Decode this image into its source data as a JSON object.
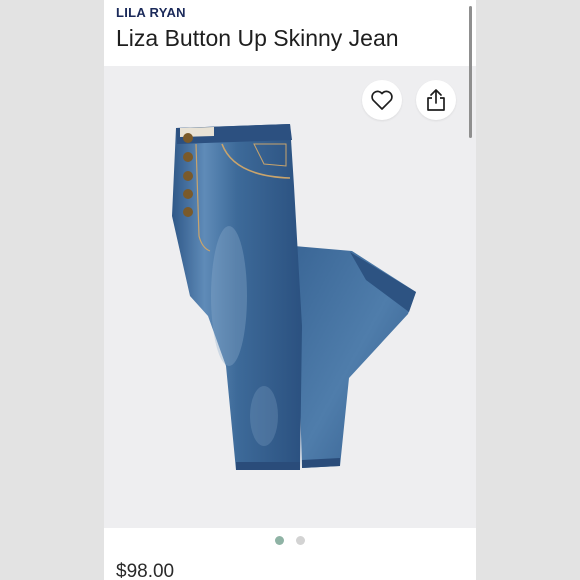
{
  "product": {
    "brand": "LILA RYAN",
    "title": "Liza Button Up Skinny Jean",
    "price": "$98.00"
  },
  "gallery": {
    "image_count": 2,
    "active_index": 0
  },
  "icons": {
    "favorite": "heart-outline-icon",
    "share": "share-upload-icon"
  },
  "colors": {
    "brand_text": "#1b2a5a",
    "active_dot": "#8fb3a5",
    "inactive_dot": "#d3d3d3",
    "photo_background": "#eeeef0",
    "denim": "#3c6a98"
  }
}
